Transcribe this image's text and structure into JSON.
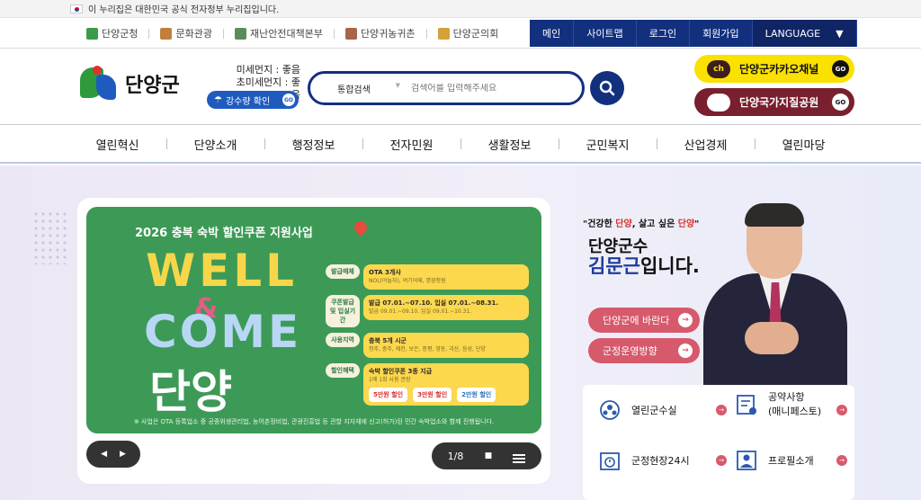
{
  "gov_notice": "이 누리집은 대한민국 공식 전자정부 누리집입니다.",
  "family_sites": [
    {
      "label": "단양군청",
      "icon": "danyang-logo-icon"
    },
    {
      "label": "문화관광",
      "icon": "suitcase-icon"
    },
    {
      "label": "재난안전대책본부",
      "icon": "building-icon"
    },
    {
      "label": "단양귀농귀촌",
      "icon": "house-icon"
    },
    {
      "label": "단양군의회",
      "icon": "council-icon"
    }
  ],
  "top_nav": [
    "메인",
    "사이트맵",
    "로그인",
    "회원가입"
  ],
  "language_label": "LANGUAGE",
  "logo_text": "단양군",
  "air": {
    "fine_dust": "미세먼지 : 좋음",
    "ultrafine_dust": "초미세먼지 : 좋음"
  },
  "rain_button": "강수량 확인",
  "go_label": "GO",
  "search": {
    "category": "통합검색",
    "placeholder": "검색어를 입력해주세요"
  },
  "kakao_label": "단양군카카오채널",
  "kakao_icon_text": "ch",
  "park_label": "단양국가지질공원",
  "gnb": [
    "열린혁신",
    "단양소개",
    "행정정보",
    "전자민원",
    "생활정보",
    "군민복지",
    "산업경제",
    "열린마당"
  ],
  "banner": {
    "title": "2026 충북 숙박 할인쿠폰 지원사업",
    "word1": "WELL",
    "amp": "&",
    "word2": "COME",
    "word3": "단양",
    "rows": [
      {
        "label": "발급매체",
        "value": "OTA 3개사",
        "sub": "NOL(야놀자), 여기어때, 명광청원"
      },
      {
        "label": "쿠폰발급 및 입실기간",
        "value": "발급 07.01.~07.10. 입실 07.01.~08.31.",
        "sub": "발급 09.01.~09.10. 입실 09.01.~10.31."
      },
      {
        "label": "사용지역",
        "value": "충북 5개 시군",
        "sub": "청주, 충주, 제천, 보은, 증평, 영동, 괴산, 음성, 단양"
      },
      {
        "label": "할인혜택",
        "value": "숙박 할인쿠폰 3종 지급",
        "sub": "1매 1회 사용 권장"
      }
    ],
    "coupons": [
      "5만원 할인",
      "3만원 할인",
      "2만원 할인"
    ],
    "footnote": "※ 사업은 OTA 등록업소 중 공중위생관리법, 농어촌정비법, 관광진흥법 등 관할 지자체에 신고(허가)된 민간 숙박업소와 함께 진행됩니다."
  },
  "slider_pager": "1/8",
  "slider_prev_icon": "◀",
  "slider_next_icon": "▶",
  "slider_stop_icon": "■",
  "mayor": {
    "slogan_prefix": "\"건강한 ",
    "slogan_red1": "단양",
    "slogan_mid": ", 살고 싶은 ",
    "slogan_red2": "단양",
    "slogan_suffix": "\"",
    "title": "단양군수",
    "name": "김문근",
    "name_suffix": "입니다."
  },
  "mayor_pills": [
    "단양군에 바란다",
    "군정운영방향"
  ],
  "quick_links": [
    "열린군수실",
    "공약사항\n(매니페스토)",
    "군정현장24시",
    "프로필소개"
  ],
  "arrow": "→",
  "colors": {
    "navy": "#13307f",
    "kakao_yellow": "#fae100",
    "park_maroon": "#7a1f2e",
    "banner_green": "#3c9a56",
    "pill_pink": "#d65a6c"
  }
}
